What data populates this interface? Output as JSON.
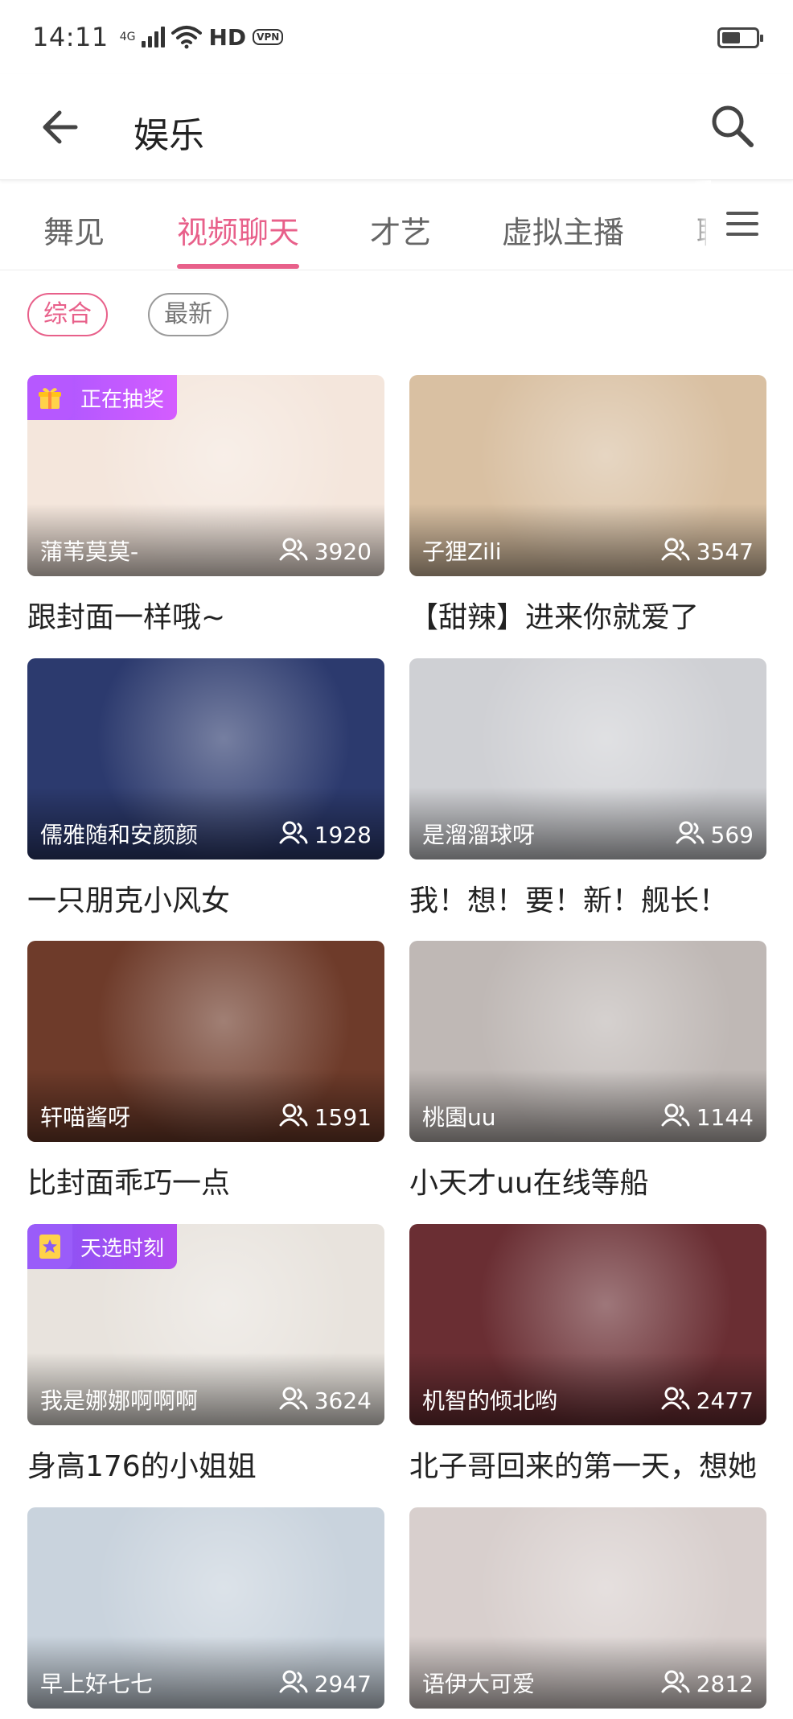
{
  "status_bar": {
    "time": "14:11",
    "network_label": "4G",
    "hd_label": "HD",
    "vpn_label": "VPN",
    "battery_level": 0.55
  },
  "header": {
    "title": "娱乐",
    "back_icon": "arrow-left-icon",
    "search_icon": "search-icon"
  },
  "tabs": {
    "items": [
      {
        "label": "舞见"
      },
      {
        "label": "视频聊天"
      },
      {
        "label": "才艺"
      },
      {
        "label": "虚拟主播"
      },
      {
        "label": "聊"
      }
    ],
    "active_index": 1,
    "menu_icon": "hamburger-menu-icon"
  },
  "filters": {
    "items": [
      {
        "label": "综合"
      },
      {
        "label": "最新"
      }
    ],
    "active_index": 0
  },
  "colors": {
    "accent": "#e8608a",
    "badge_lottery": "#b658ff",
    "badge_pick": "#9a5cf9"
  },
  "rooms": [
    {
      "streamer": "蒲苇莫莫-",
      "viewers": "3920",
      "title": "跟封面一样哦~",
      "badge": "正在抽奖",
      "cover_color": "#f4e6dc"
    },
    {
      "streamer": "子狸Zili",
      "viewers": "3547",
      "title": "【甜辣】进来你就爱了",
      "badge": "",
      "cover_color": "#d9c0a2"
    },
    {
      "streamer": "儒雅随和安颜颜",
      "viewers": "1928",
      "title": "一只朋克小风女",
      "badge": "",
      "cover_color": "#2c3a6e"
    },
    {
      "streamer": "是溜溜球呀",
      "viewers": "569",
      "title": "我！想！要！新！舰长！",
      "badge": "",
      "cover_color": "#cfd0d4"
    },
    {
      "streamer": "轩喵酱呀",
      "viewers": "1591",
      "title": "比封面乖巧一点",
      "badge": "",
      "cover_color": "#6e3b2a"
    },
    {
      "streamer": "桃園uu",
      "viewers": "1144",
      "title": "小天才uu在线等船",
      "badge": "",
      "cover_color": "#bfb8b5"
    },
    {
      "streamer": "我是娜娜啊啊啊",
      "viewers": "3624",
      "title": "身高176的小姐姐",
      "badge": "天选时刻",
      "cover_color": "#e8e3dd"
    },
    {
      "streamer": "机智的倾北哟",
      "viewers": "2477",
      "title": "北子哥回来的第一天，想她",
      "badge": "",
      "cover_color": "#6a2e33"
    },
    {
      "streamer": "早上好七七",
      "viewers": "2947",
      "title": "",
      "badge": "",
      "cover_color": "#c9d3dd"
    },
    {
      "streamer": "语伊大可爱",
      "viewers": "2812",
      "title": "",
      "badge": "",
      "cover_color": "#d8cfcd"
    }
  ]
}
